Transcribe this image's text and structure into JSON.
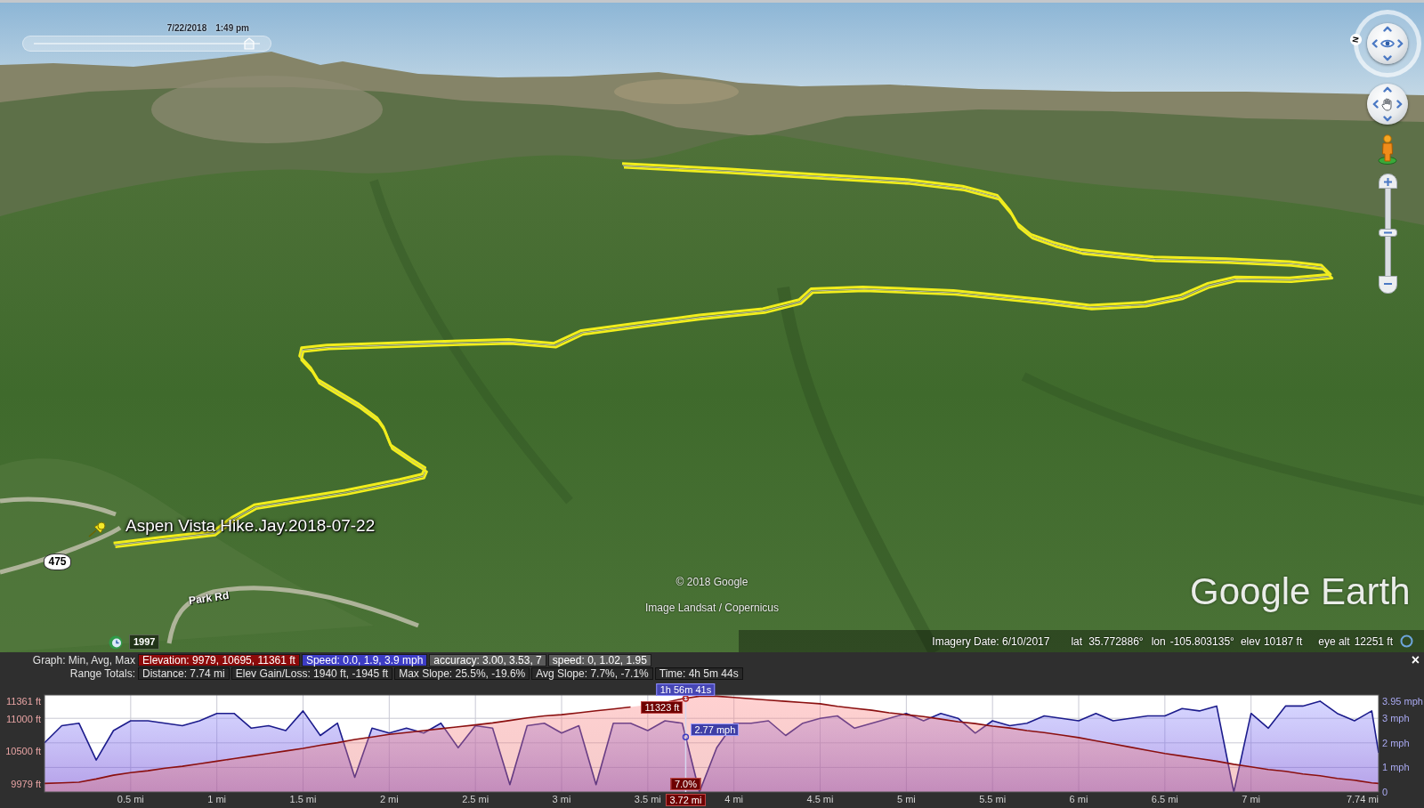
{
  "map": {
    "time_slider": {
      "date": "7/22/2018",
      "time": "1:49 pm",
      "level": 0.94
    },
    "compass": {
      "north_label": "N"
    },
    "zoom_slider": {
      "level": 0.5
    },
    "placemark": {
      "label": "Aspen Vista Hike.Jay.2018-07-22"
    },
    "road_shield": "475",
    "road_label": "Park Rd",
    "historical_imagery": {
      "year": "1997"
    },
    "attribution": [
      "© 2018 Google",
      "Image Landsat / Copernicus"
    ],
    "logo": "Google Earth",
    "status_bar": {
      "imagery_date": "Imagery Date: 6/10/2017",
      "lat_label": "lat",
      "lat": "35.772886°",
      "lon_label": "lon",
      "lon": "-105.803135°",
      "elev_label": "elev",
      "elev": "10187 ft",
      "eye_alt_label": "eye alt",
      "eye_alt": "12251 ft"
    }
  },
  "elevation_profile": {
    "close_label": "×",
    "rows": [
      {
        "label": "Graph: Min, Avg, Max",
        "items": [
          {
            "text": "Elevation: 9979, 10695, 11361 ft",
            "color": "#8c0a0a"
          },
          {
            "text": "Speed: 0.0, 1.9, 3.9 mph",
            "color": "#3c3cc4"
          },
          {
            "text": "accuracy: 3.00, 3.53, 7",
            "color": "#5a5a5a"
          },
          {
            "text": "speed: 0, 1.02, 1.95",
            "color": "#5a5a5a"
          }
        ]
      },
      {
        "label": "Range Totals:",
        "items": [
          {
            "text": "Distance: 7.74 mi"
          },
          {
            "text": "Elev Gain/Loss: 1940 ft, -1945 ft"
          },
          {
            "text": "Max Slope: 25.5%, -19.6%"
          },
          {
            "text": "Avg Slope: 7.7%, -7.1%"
          },
          {
            "text": "Time: 4h 5m 44s"
          }
        ]
      }
    ],
    "cursor": {
      "time": "1h 56m 41s",
      "speed": "2.77 mph",
      "slope": "7.0%",
      "distance": "3.72 mi"
    },
    "chart_data": {
      "type": "area",
      "grid": true,
      "x": [
        0,
        0.1,
        0.2,
        0.3,
        0.4,
        0.5,
        0.6,
        0.7,
        0.8,
        0.9,
        1,
        1.1,
        1.2,
        1.3,
        1.4,
        1.5,
        1.6,
        1.7,
        1.8,
        1.9,
        2,
        2.1,
        2.2,
        2.3,
        2.4,
        2.5,
        2.6,
        2.7,
        2.8,
        2.9,
        3,
        3.1,
        3.2,
        3.3,
        3.4,
        3.5,
        3.6,
        3.7,
        3.8,
        3.9,
        4,
        4.1,
        4.2,
        4.3,
        4.4,
        4.5,
        4.6,
        4.7,
        4.8,
        4.9,
        5,
        5.1,
        5.2,
        5.3,
        5.4,
        5.5,
        5.6,
        5.7,
        5.8,
        5.9,
        6,
        6.1,
        6.2,
        6.3,
        6.4,
        6.5,
        6.6,
        6.7,
        6.8,
        6.9,
        7,
        7.1,
        7.2,
        7.3,
        7.4,
        7.5,
        7.6,
        7.7,
        7.74
      ],
      "series": [
        {
          "color": "#8b1010",
          "values": [
            9990,
            10000,
            10010,
            10060,
            10120,
            10160,
            10190,
            10230,
            10260,
            10300,
            10340,
            10380,
            10420,
            10460,
            10500,
            10540,
            10590,
            10630,
            10680,
            10720,
            10760,
            10790,
            10820,
            10850,
            10880,
            10910,
            10940,
            10980,
            11020,
            11050,
            11070,
            11100,
            11130,
            11160,
            11190,
            null,
            11260,
            11320,
            11360,
            11360,
            11340,
            11320,
            11300,
            11280,
            11260,
            11240,
            11200,
            11170,
            11140,
            11100,
            11070,
            11040,
            11000,
            10960,
            10930,
            10890,
            10860,
            10820,
            10790,
            10750,
            10710,
            10660,
            10610,
            10560,
            10510,
            10460,
            10420,
            10380,
            10340,
            10290,
            10250,
            10210,
            10180,
            10140,
            10110,
            10070,
            10040,
            10000,
            9990
          ]
        },
        {
          "color": "#1c1c8c",
          "axis": "y2",
          "values": [
            2,
            2.7,
            2.8,
            1.3,
            2.5,
            2.9,
            2.9,
            2.8,
            2.7,
            2.9,
            3.2,
            3.2,
            2.6,
            2.7,
            2.5,
            3.3,
            2.3,
            2.8,
            0.6,
            2.6,
            2.4,
            2.6,
            2.4,
            2.8,
            1.8,
            2.7,
            2.6,
            0.3,
            2.7,
            2.8,
            2.4,
            2.7,
            0.3,
            2.8,
            2.8,
            2.5,
            2.9,
            2.8,
            0,
            1.8,
            2.8,
            2.8,
            2.9,
            2.3,
            2.8,
            3,
            3.1,
            2.6,
            2.8,
            3,
            3.2,
            2.9,
            3.2,
            3,
            2.4,
            2.9,
            2.7,
            2.8,
            3.1,
            3,
            2.9,
            3.2,
            2.9,
            3,
            3.1,
            3.1,
            3.4,
            3.3,
            3.5,
            0,
            3.2,
            2.6,
            3.5,
            3.5,
            3.7,
            3.2,
            2.9,
            3.3,
            1.6
          ]
        }
      ],
      "xlim": [
        0,
        7.74
      ],
      "xticks": [
        {
          "value": 0.5,
          "label": "0.5 mi"
        },
        {
          "value": 1,
          "label": "1 mi"
        },
        {
          "value": 1.5,
          "label": "1.5 mi"
        },
        {
          "value": 2,
          "label": "2 mi"
        },
        {
          "value": 2.5,
          "label": "2.5 mi"
        },
        {
          "value": 3,
          "label": "3 mi"
        },
        {
          "value": 3.5,
          "label": "3.5 mi"
        },
        {
          "value": 4,
          "label": "4 mi"
        },
        {
          "value": 4.5,
          "label": "4.5 mi"
        },
        {
          "value": 5,
          "label": "5 mi"
        },
        {
          "value": 5.5,
          "label": "5.5 mi"
        },
        {
          "value": 6,
          "label": "6 mi"
        },
        {
          "value": 6.5,
          "label": "6.5 mi"
        },
        {
          "value": 7,
          "label": "7 mi"
        },
        {
          "value": 7.74,
          "label": "7.74 mi"
        }
      ],
      "ylim": [
        9856,
        11379
      ],
      "yticks": [
        {
          "value": 11361,
          "label": "11361 ft"
        },
        {
          "value": 11000,
          "label": "11000 ft"
        },
        {
          "value": 10500,
          "label": "10500 ft"
        },
        {
          "value": 9979,
          "label": "9979 ft"
        }
      ],
      "y2lim": [
        0,
        3.95
      ],
      "y2ticks": [
        {
          "value": 3.95,
          "label": "3.95 mph"
        },
        {
          "value": 3,
          "label": "3 mph"
        },
        {
          "value": 2,
          "label": "2 mph"
        },
        {
          "value": 1,
          "label": "1 mph"
        },
        {
          "value": 0,
          "label": "0"
        }
      ],
      "ref_lines": [
        {
          "axis": "x",
          "value": 3.72
        }
      ],
      "annotations": [
        {
          "x": 3.72,
          "y": 11323,
          "text": "11323 ft"
        }
      ]
    }
  }
}
